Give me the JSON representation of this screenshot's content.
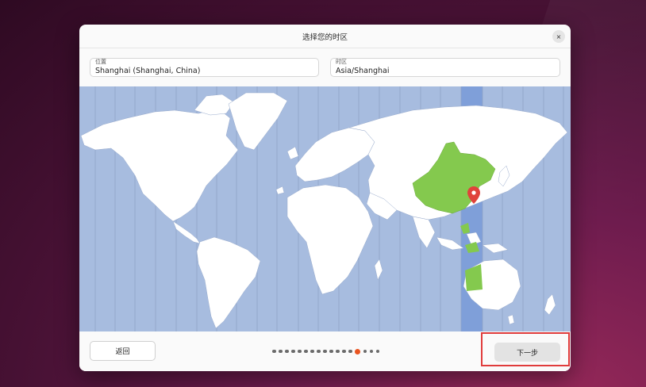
{
  "window": {
    "title": "选择您的时区",
    "close_icon": "×"
  },
  "location": {
    "label": "位置",
    "value": "Shanghai (Shanghai, China)"
  },
  "timezone": {
    "label": "时区",
    "value": "Asia/Shanghai"
  },
  "map": {
    "selected_region": "China",
    "selected_zone": "Asia/Shanghai",
    "colors": {
      "ocean": "#a7bcdf",
      "land": "#ffffff",
      "highlight_band": "#7f9fd9",
      "selected_land": "#84c94e",
      "marker": "#e0423b"
    }
  },
  "footer": {
    "back_label": "返回",
    "next_label": "下一步",
    "steps_total": 17,
    "steps_current": 14
  }
}
